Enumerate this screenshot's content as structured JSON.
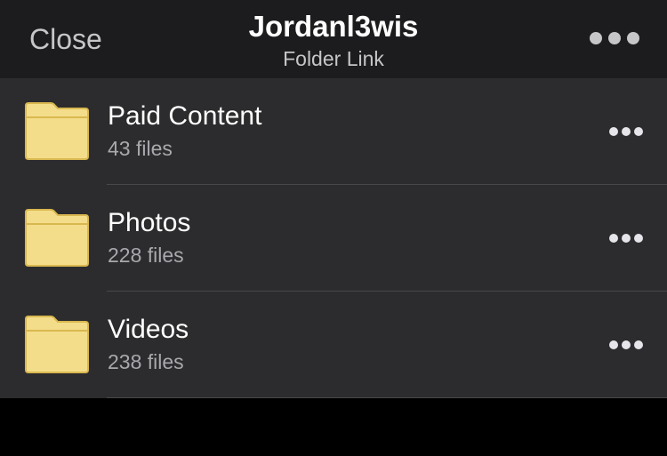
{
  "navbar": {
    "close_label": "Close",
    "title": "Jordanl3wis",
    "subtitle": "Folder Link",
    "more_icon": "more-horizontal-icon"
  },
  "folders": [
    {
      "name": "Paid Content",
      "count": "43 files",
      "icon": "folder-icon"
    },
    {
      "name": "Photos",
      "count": "228 files",
      "icon": "folder-icon"
    },
    {
      "name": "Videos",
      "count": "238 files",
      "icon": "folder-icon"
    }
  ],
  "colors": {
    "navbar_bg": "#1c1c1e",
    "list_bg": "#2c2c2e",
    "folder_fill": "#f4dd8a",
    "folder_stroke": "#d9b850",
    "page_bg": "#000000"
  }
}
